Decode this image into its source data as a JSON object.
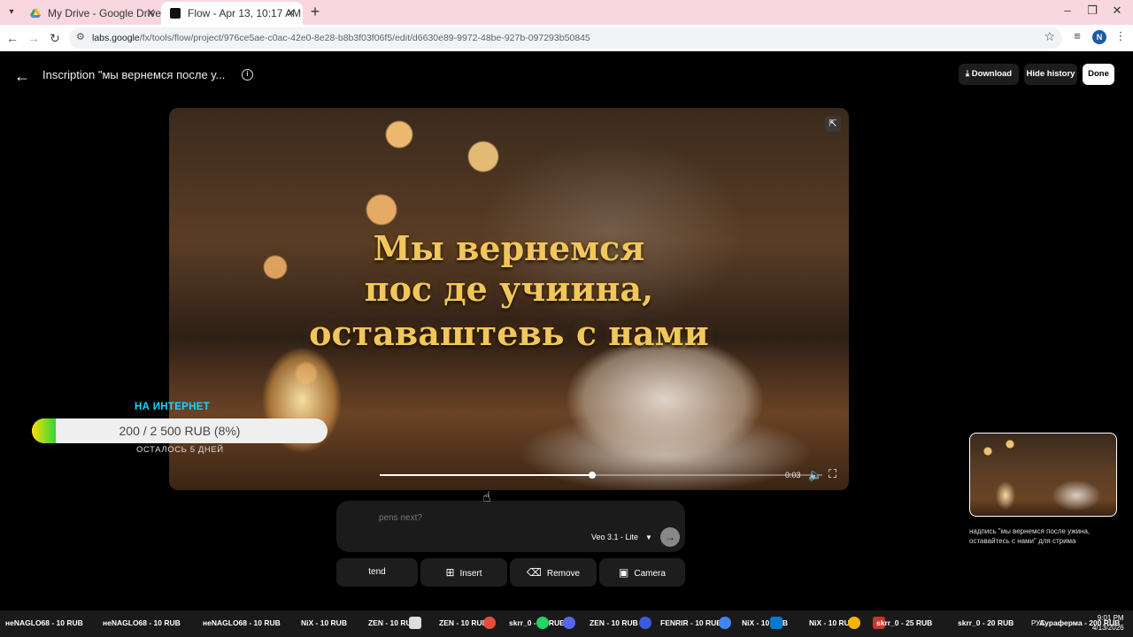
{
  "browser": {
    "tabs": [
      {
        "title": "My Drive - Google Drive"
      },
      {
        "title": "Flow - Apr 13, 10:17 AM"
      }
    ],
    "url_host": "labs.google",
    "url_path": "/fx/tools/flow/project/976ce5ae-c0ac-42e0-8e28-b8b3f03f06f5/edit/d6630e89-9972-48be-927b-097293b50845",
    "profile_initial": "N"
  },
  "header": {
    "title": "Inscription \"мы вернемся после у...",
    "download_label": "Download",
    "hide_history_label": "Hide history",
    "done_label": "Done"
  },
  "video": {
    "overlay_lines": [
      "Мы вернемся",
      "пос де учиина,",
      "оставаштевь с нами"
    ],
    "time": "0:03",
    "progress": 0.48
  },
  "prompt": {
    "placeholder": "What happens next?",
    "placeholder_visible": "pens next?",
    "model": "Veo 3.1 - Lite"
  },
  "actions": {
    "extend": "Extend",
    "extend_visible": "tend",
    "insert": "Insert",
    "remove": "Remove",
    "camera": "Camera"
  },
  "history": {
    "caption": "надпись \"мы вернемся после ужина, оставайтесь с нами\" для стрима"
  },
  "stream_overlay": {
    "heading": "НА ИНТЕРНЕТ",
    "goal_text": "200 / 2 500 RUB (8%)",
    "goal_fraction": 0.08,
    "subtext": "ОСТАЛОСЬ 5 ДНЕЙ"
  },
  "taskbar": {
    "items": [
      "неNAGLO68 - 10 RUB",
      "неNAGLO68 - 10 RUB",
      "неNAGLO68 - 10 RUB",
      "NiX - 10 RUB",
      "ZEN - 10 RUB",
      "ZEN - 10 RUB",
      "skrr_0 - 64 RUB",
      "ZEN - 10 RUB",
      "FENRIR - 10 RUB",
      "NiX - 10 RUB",
      "NiX - 10 RUB",
      "skrr_0 - 25 RUB",
      "skrr_0 - 20 RUB",
      "Аураферма - 200 RUB"
    ],
    "lang": "РУС",
    "time": "9:01 PM",
    "date": "4/13/2026"
  },
  "colors": {
    "accent_cyan": "#11d8ff",
    "video_text_gold": "#f1c75c",
    "tab_strip": "#f8d7e1"
  }
}
